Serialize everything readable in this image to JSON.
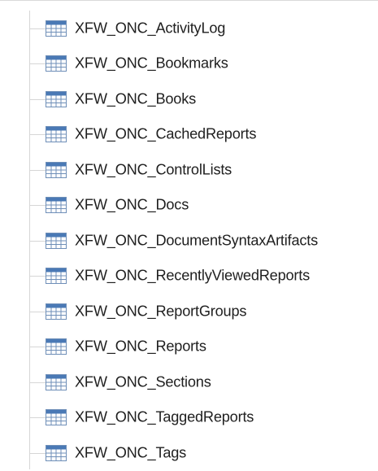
{
  "tree": {
    "items": [
      {
        "label": "XFW_ONC_ActivityLog",
        "icon": "table-icon"
      },
      {
        "label": "XFW_ONC_Bookmarks",
        "icon": "table-icon"
      },
      {
        "label": "XFW_ONC_Books",
        "icon": "table-icon"
      },
      {
        "label": "XFW_ONC_CachedReports",
        "icon": "table-icon"
      },
      {
        "label": "XFW_ONC_ControlLists",
        "icon": "table-icon"
      },
      {
        "label": "XFW_ONC_Docs",
        "icon": "table-icon"
      },
      {
        "label": "XFW_ONC_DocumentSyntaxArtifacts",
        "icon": "table-icon"
      },
      {
        "label": "XFW_ONC_RecentlyViewedReports",
        "icon": "table-icon"
      },
      {
        "label": "XFW_ONC_ReportGroups",
        "icon": "table-icon"
      },
      {
        "label": "XFW_ONC_Reports",
        "icon": "table-icon"
      },
      {
        "label": "XFW_ONC_Sections",
        "icon": "table-icon"
      },
      {
        "label": "XFW_ONC_TaggedReports",
        "icon": "table-icon"
      },
      {
        "label": "XFW_ONC_Tags",
        "icon": "table-icon"
      }
    ]
  },
  "colors": {
    "icon_header": "#4a79b5",
    "icon_border": "#6f8fb8",
    "icon_cell": "#ffffff",
    "tree_lines": "#d6d6d6"
  }
}
